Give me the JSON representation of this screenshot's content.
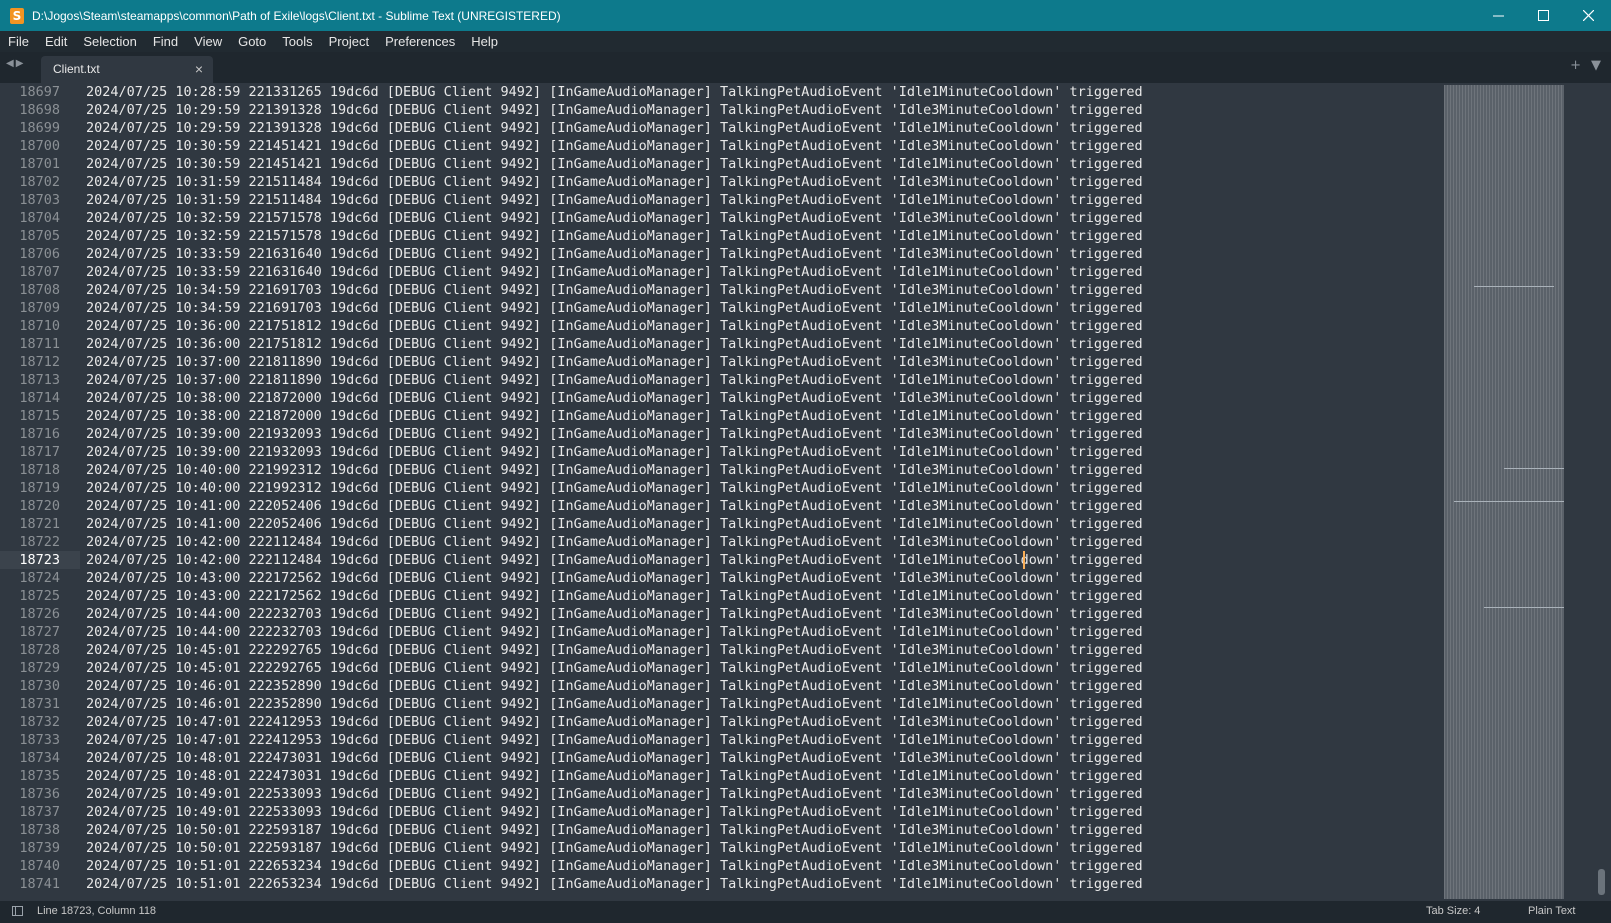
{
  "window": {
    "title": "D:\\Jogos\\Steam\\steamapps\\common\\Path of Exile\\logs\\Client.txt - Sublime Text (UNREGISTERED)"
  },
  "menu": [
    {
      "label": "File"
    },
    {
      "label": "Edit"
    },
    {
      "label": "Selection"
    },
    {
      "label": "Find"
    },
    {
      "label": "View"
    },
    {
      "label": "Goto"
    },
    {
      "label": "Tools"
    },
    {
      "label": "Project"
    },
    {
      "label": "Preferences"
    },
    {
      "label": "Help"
    }
  ],
  "tab": {
    "label": "Client.txt"
  },
  "editor": {
    "current_line": 18723,
    "lines": [
      {
        "n": "18697",
        "text": "2024/07/25 10:28:59 221331265 19dc6d [DEBUG Client 9492] [InGameAudioManager] TalkingPetAudioEvent 'Idle1MinuteCooldown' triggered"
      },
      {
        "n": "18698",
        "text": "2024/07/25 10:29:59 221391328 19dc6d [DEBUG Client 9492] [InGameAudioManager] TalkingPetAudioEvent 'Idle3MinuteCooldown' triggered"
      },
      {
        "n": "18699",
        "text": "2024/07/25 10:29:59 221391328 19dc6d [DEBUG Client 9492] [InGameAudioManager] TalkingPetAudioEvent 'Idle1MinuteCooldown' triggered"
      },
      {
        "n": "18700",
        "text": "2024/07/25 10:30:59 221451421 19dc6d [DEBUG Client 9492] [InGameAudioManager] TalkingPetAudioEvent 'Idle3MinuteCooldown' triggered"
      },
      {
        "n": "18701",
        "text": "2024/07/25 10:30:59 221451421 19dc6d [DEBUG Client 9492] [InGameAudioManager] TalkingPetAudioEvent 'Idle1MinuteCooldown' triggered"
      },
      {
        "n": "18702",
        "text": "2024/07/25 10:31:59 221511484 19dc6d [DEBUG Client 9492] [InGameAudioManager] TalkingPetAudioEvent 'Idle3MinuteCooldown' triggered"
      },
      {
        "n": "18703",
        "text": "2024/07/25 10:31:59 221511484 19dc6d [DEBUG Client 9492] [InGameAudioManager] TalkingPetAudioEvent 'Idle1MinuteCooldown' triggered"
      },
      {
        "n": "18704",
        "text": "2024/07/25 10:32:59 221571578 19dc6d [DEBUG Client 9492] [InGameAudioManager] TalkingPetAudioEvent 'Idle3MinuteCooldown' triggered"
      },
      {
        "n": "18705",
        "text": "2024/07/25 10:32:59 221571578 19dc6d [DEBUG Client 9492] [InGameAudioManager] TalkingPetAudioEvent 'Idle1MinuteCooldown' triggered"
      },
      {
        "n": "18706",
        "text": "2024/07/25 10:33:59 221631640 19dc6d [DEBUG Client 9492] [InGameAudioManager] TalkingPetAudioEvent 'Idle3MinuteCooldown' triggered"
      },
      {
        "n": "18707",
        "text": "2024/07/25 10:33:59 221631640 19dc6d [DEBUG Client 9492] [InGameAudioManager] TalkingPetAudioEvent 'Idle1MinuteCooldown' triggered"
      },
      {
        "n": "18708",
        "text": "2024/07/25 10:34:59 221691703 19dc6d [DEBUG Client 9492] [InGameAudioManager] TalkingPetAudioEvent 'Idle3MinuteCooldown' triggered"
      },
      {
        "n": "18709",
        "text": "2024/07/25 10:34:59 221691703 19dc6d [DEBUG Client 9492] [InGameAudioManager] TalkingPetAudioEvent 'Idle1MinuteCooldown' triggered"
      },
      {
        "n": "18710",
        "text": "2024/07/25 10:36:00 221751812 19dc6d [DEBUG Client 9492] [InGameAudioManager] TalkingPetAudioEvent 'Idle3MinuteCooldown' triggered"
      },
      {
        "n": "18711",
        "text": "2024/07/25 10:36:00 221751812 19dc6d [DEBUG Client 9492] [InGameAudioManager] TalkingPetAudioEvent 'Idle1MinuteCooldown' triggered"
      },
      {
        "n": "18712",
        "text": "2024/07/25 10:37:00 221811890 19dc6d [DEBUG Client 9492] [InGameAudioManager] TalkingPetAudioEvent 'Idle3MinuteCooldown' triggered"
      },
      {
        "n": "18713",
        "text": "2024/07/25 10:37:00 221811890 19dc6d [DEBUG Client 9492] [InGameAudioManager] TalkingPetAudioEvent 'Idle1MinuteCooldown' triggered"
      },
      {
        "n": "18714",
        "text": "2024/07/25 10:38:00 221872000 19dc6d [DEBUG Client 9492] [InGameAudioManager] TalkingPetAudioEvent 'Idle3MinuteCooldown' triggered"
      },
      {
        "n": "18715",
        "text": "2024/07/25 10:38:00 221872000 19dc6d [DEBUG Client 9492] [InGameAudioManager] TalkingPetAudioEvent 'Idle1MinuteCooldown' triggered"
      },
      {
        "n": "18716",
        "text": "2024/07/25 10:39:00 221932093 19dc6d [DEBUG Client 9492] [InGameAudioManager] TalkingPetAudioEvent 'Idle3MinuteCooldown' triggered"
      },
      {
        "n": "18717",
        "text": "2024/07/25 10:39:00 221932093 19dc6d [DEBUG Client 9492] [InGameAudioManager] TalkingPetAudioEvent 'Idle1MinuteCooldown' triggered"
      },
      {
        "n": "18718",
        "text": "2024/07/25 10:40:00 221992312 19dc6d [DEBUG Client 9492] [InGameAudioManager] TalkingPetAudioEvent 'Idle3MinuteCooldown' triggered"
      },
      {
        "n": "18719",
        "text": "2024/07/25 10:40:00 221992312 19dc6d [DEBUG Client 9492] [InGameAudioManager] TalkingPetAudioEvent 'Idle1MinuteCooldown' triggered"
      },
      {
        "n": "18720",
        "text": "2024/07/25 10:41:00 222052406 19dc6d [DEBUG Client 9492] [InGameAudioManager] TalkingPetAudioEvent 'Idle3MinuteCooldown' triggered"
      },
      {
        "n": "18721",
        "text": "2024/07/25 10:41:00 222052406 19dc6d [DEBUG Client 9492] [InGameAudioManager] TalkingPetAudioEvent 'Idle1MinuteCooldown' triggered"
      },
      {
        "n": "18722",
        "text": "2024/07/25 10:42:00 222112484 19dc6d [DEBUG Client 9492] [InGameAudioManager] TalkingPetAudioEvent 'Idle3MinuteCooldown' triggered"
      },
      {
        "n": "18723",
        "text": "2024/07/25 10:42:00 222112484 19dc6d [DEBUG Client 9492] [InGameAudioManager] TalkingPetAudioEvent 'Idle1MinuteCooldown' triggered"
      },
      {
        "n": "18724",
        "text": "2024/07/25 10:43:00 222172562 19dc6d [DEBUG Client 9492] [InGameAudioManager] TalkingPetAudioEvent 'Idle3MinuteCooldown' triggered"
      },
      {
        "n": "18725",
        "text": "2024/07/25 10:43:00 222172562 19dc6d [DEBUG Client 9492] [InGameAudioManager] TalkingPetAudioEvent 'Idle1MinuteCooldown' triggered"
      },
      {
        "n": "18726",
        "text": "2024/07/25 10:44:00 222232703 19dc6d [DEBUG Client 9492] [InGameAudioManager] TalkingPetAudioEvent 'Idle3MinuteCooldown' triggered"
      },
      {
        "n": "18727",
        "text": "2024/07/25 10:44:00 222232703 19dc6d [DEBUG Client 9492] [InGameAudioManager] TalkingPetAudioEvent 'Idle1MinuteCooldown' triggered"
      },
      {
        "n": "18728",
        "text": "2024/07/25 10:45:01 222292765 19dc6d [DEBUG Client 9492] [InGameAudioManager] TalkingPetAudioEvent 'Idle3MinuteCooldown' triggered"
      },
      {
        "n": "18729",
        "text": "2024/07/25 10:45:01 222292765 19dc6d [DEBUG Client 9492] [InGameAudioManager] TalkingPetAudioEvent 'Idle1MinuteCooldown' triggered"
      },
      {
        "n": "18730",
        "text": "2024/07/25 10:46:01 222352890 19dc6d [DEBUG Client 9492] [InGameAudioManager] TalkingPetAudioEvent 'Idle3MinuteCooldown' triggered"
      },
      {
        "n": "18731",
        "text": "2024/07/25 10:46:01 222352890 19dc6d [DEBUG Client 9492] [InGameAudioManager] TalkingPetAudioEvent 'Idle1MinuteCooldown' triggered"
      },
      {
        "n": "18732",
        "text": "2024/07/25 10:47:01 222412953 19dc6d [DEBUG Client 9492] [InGameAudioManager] TalkingPetAudioEvent 'Idle3MinuteCooldown' triggered"
      },
      {
        "n": "18733",
        "text": "2024/07/25 10:47:01 222412953 19dc6d [DEBUG Client 9492] [InGameAudioManager] TalkingPetAudioEvent 'Idle1MinuteCooldown' triggered"
      },
      {
        "n": "18734",
        "text": "2024/07/25 10:48:01 222473031 19dc6d [DEBUG Client 9492] [InGameAudioManager] TalkingPetAudioEvent 'Idle3MinuteCooldown' triggered"
      },
      {
        "n": "18735",
        "text": "2024/07/25 10:48:01 222473031 19dc6d [DEBUG Client 9492] [InGameAudioManager] TalkingPetAudioEvent 'Idle1MinuteCooldown' triggered"
      },
      {
        "n": "18736",
        "text": "2024/07/25 10:49:01 222533093 19dc6d [DEBUG Client 9492] [InGameAudioManager] TalkingPetAudioEvent 'Idle3MinuteCooldown' triggered"
      },
      {
        "n": "18737",
        "text": "2024/07/25 10:49:01 222533093 19dc6d [DEBUG Client 9492] [InGameAudioManager] TalkingPetAudioEvent 'Idle1MinuteCooldown' triggered"
      },
      {
        "n": "18738",
        "text": "2024/07/25 10:50:01 222593187 19dc6d [DEBUG Client 9492] [InGameAudioManager] TalkingPetAudioEvent 'Idle3MinuteCooldown' triggered"
      },
      {
        "n": "18739",
        "text": "2024/07/25 10:50:01 222593187 19dc6d [DEBUG Client 9492] [InGameAudioManager] TalkingPetAudioEvent 'Idle1MinuteCooldown' triggered"
      },
      {
        "n": "18740",
        "text": "2024/07/25 10:51:01 222653234 19dc6d [DEBUG Client 9492] [InGameAudioManager] TalkingPetAudioEvent 'Idle3MinuteCooldown' triggered"
      },
      {
        "n": "18741",
        "text": "2024/07/25 10:51:01 222653234 19dc6d [DEBUG Client 9492] [InGameAudioManager] TalkingPetAudioEvent 'Idle1MinuteCooldown' triggered"
      }
    ]
  },
  "status": {
    "position": "Line 18723, Column 118",
    "tab_size": "Tab Size: 4",
    "syntax": "Plain Text"
  },
  "colors": {
    "titlebar": "#0d7a8c",
    "editor_bg": "#303841",
    "cursor": "#f9ae58"
  },
  "icons": [
    "sublime-text-icon",
    "minimize-icon",
    "maximize-icon",
    "close-icon",
    "tab-back-icon",
    "tab-forward-icon",
    "tab-close-icon",
    "new-tab-icon",
    "tab-list-icon",
    "sidebar-toggle-icon"
  ]
}
